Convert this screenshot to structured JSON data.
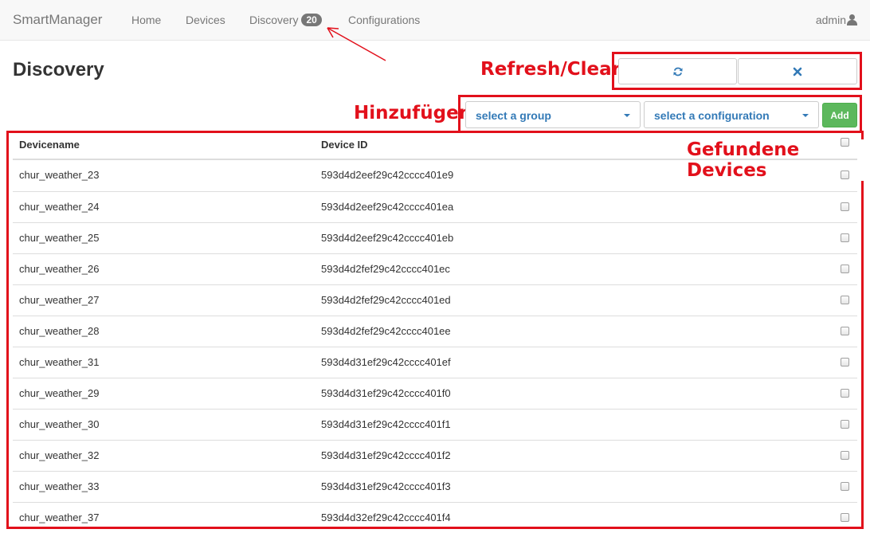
{
  "navbar": {
    "brand": "SmartManager",
    "items": [
      {
        "label": "Home"
      },
      {
        "label": "Devices"
      },
      {
        "label": "Discovery",
        "badge": "20"
      },
      {
        "label": "Configurations"
      }
    ],
    "user": "admin"
  },
  "page": {
    "title": "Discovery"
  },
  "annotations": {
    "refresh_clear": "Refresh/Clear",
    "add": "Hinzufügen",
    "found_devices": "Gefundene Devices",
    "color": "#e2101b"
  },
  "actions": {
    "refresh_icon": "refresh-icon",
    "clear_icon": "close-icon"
  },
  "add_form": {
    "group_select": "select a group",
    "config_select": "select a configuration",
    "add_label": "Add"
  },
  "table": {
    "columns": [
      "Devicename",
      "Device ID"
    ],
    "rows": [
      {
        "name": "chur_weather_23",
        "id": "593d4d2eef29c42cccc401e9"
      },
      {
        "name": "chur_weather_24",
        "id": "593d4d2eef29c42cccc401ea"
      },
      {
        "name": "chur_weather_25",
        "id": "593d4d2eef29c42cccc401eb"
      },
      {
        "name": "chur_weather_26",
        "id": "593d4d2fef29c42cccc401ec"
      },
      {
        "name": "chur_weather_27",
        "id": "593d4d2fef29c42cccc401ed"
      },
      {
        "name": "chur_weather_28",
        "id": "593d4d2fef29c42cccc401ee"
      },
      {
        "name": "chur_weather_31",
        "id": "593d4d31ef29c42cccc401ef"
      },
      {
        "name": "chur_weather_29",
        "id": "593d4d31ef29c42cccc401f0"
      },
      {
        "name": "chur_weather_30",
        "id": "593d4d31ef29c42cccc401f1"
      },
      {
        "name": "chur_weather_32",
        "id": "593d4d31ef29c42cccc401f2"
      },
      {
        "name": "chur_weather_33",
        "id": "593d4d31ef29c42cccc401f3"
      },
      {
        "name": "chur_weather_37",
        "id": "593d4d32ef29c42cccc401f4"
      }
    ]
  }
}
